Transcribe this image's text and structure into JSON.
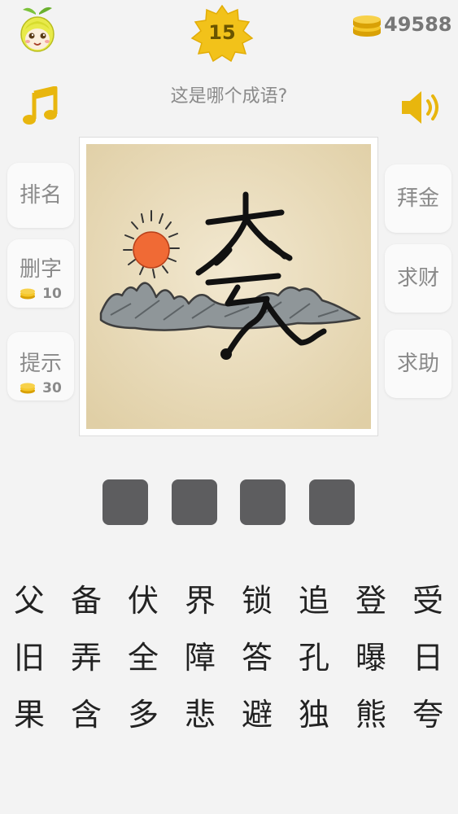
{
  "header": {
    "level": "15",
    "coins": "49588",
    "question": "这是哪个成语?"
  },
  "left_buttons": [
    {
      "label": "排名"
    },
    {
      "label": "删字",
      "cost": "10"
    },
    {
      "label": "提示",
      "cost": "30"
    }
  ],
  "right_buttons": [
    {
      "label": "拜金"
    },
    {
      "label": "求财"
    },
    {
      "label": "求助"
    }
  ],
  "puzzle": {
    "drawn_character": "夸"
  },
  "answer_slots": [
    "",
    "",
    "",
    ""
  ],
  "characters": [
    "父",
    "备",
    "伏",
    "界",
    "锁",
    "追",
    "登",
    "受",
    "旧",
    "弄",
    "全",
    "障",
    "答",
    "孔",
    "曝",
    "日",
    "果",
    "含",
    "多",
    "悲",
    "避",
    "独",
    "熊",
    "夸"
  ],
  "colors": {
    "slot": "#5d5d5f",
    "gold": "#f2c21a",
    "sun": "#f06a35",
    "mountain": "#8f9699",
    "paper": "#ecdfc1"
  },
  "icons": [
    "mascot-icon",
    "level-star-badge",
    "coin-stack-icon",
    "music-note-icon",
    "speaker-icon"
  ]
}
